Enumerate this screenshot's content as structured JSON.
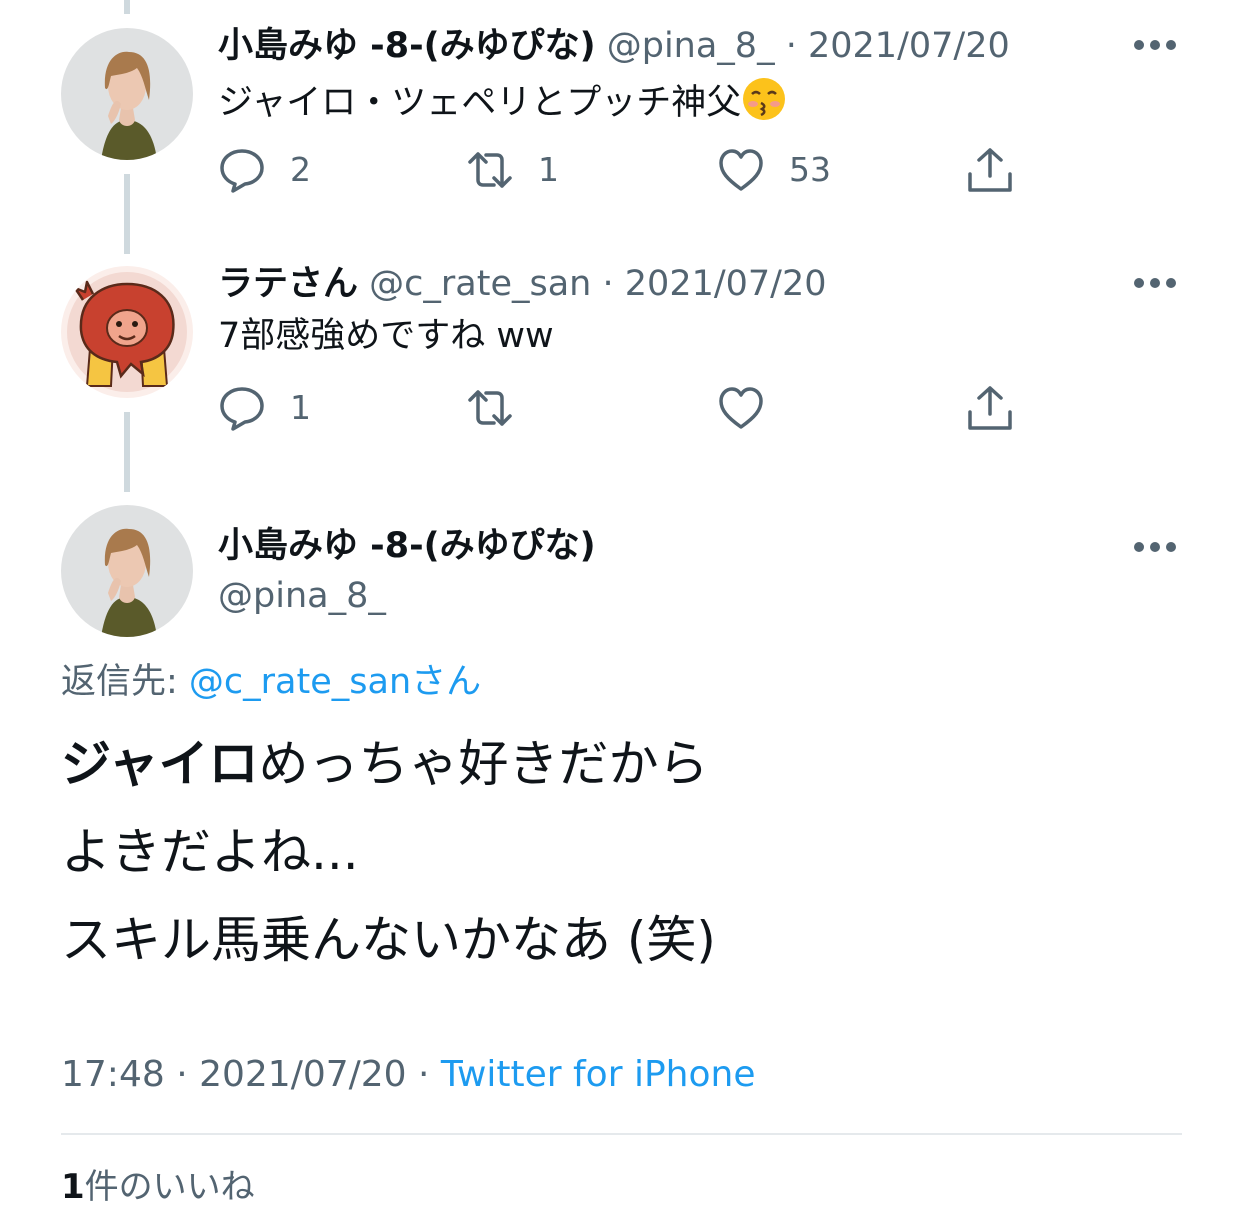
{
  "tweets": [
    {
      "name": "小島みゆ -8-(みゆぴな)",
      "handle": "@pina_8_",
      "date": "2021/07/20",
      "text": "ジャイロ・ツェペリとプッチ神父",
      "emoji": "kissing-face-with-closed-eyes",
      "reply_count": "2",
      "retweet_count": "1",
      "like_count": "53"
    },
    {
      "name": "ラテさん",
      "handle": "@c_rate_san",
      "date": "2021/07/20",
      "text": "7部感強めですね ww",
      "reply_count": "1",
      "retweet_count": "",
      "like_count": ""
    }
  ],
  "main": {
    "name": "小島みゆ -8-(みゆぴな)",
    "handle": "@pina_8_",
    "reply_label": "返信先: ",
    "reply_handle": "@c_rate_san",
    "reply_suffix": "さん",
    "text_bold": "ジャイロ",
    "text_line1_rest": "めっちゃ好きだから",
    "text_line2": "よきだよね...",
    "text_line3": "スキル馬乗んないかなあ (笑)",
    "time_date": "17:48 · 2021/07/20 · ",
    "source": "Twitter for iPhone",
    "likes_count": "1",
    "likes_label": "件のいいね"
  },
  "colors": {
    "text": "#0f1419",
    "secondary": "#536471",
    "link": "#1d9bf0",
    "thread_line": "#cfd9de"
  }
}
